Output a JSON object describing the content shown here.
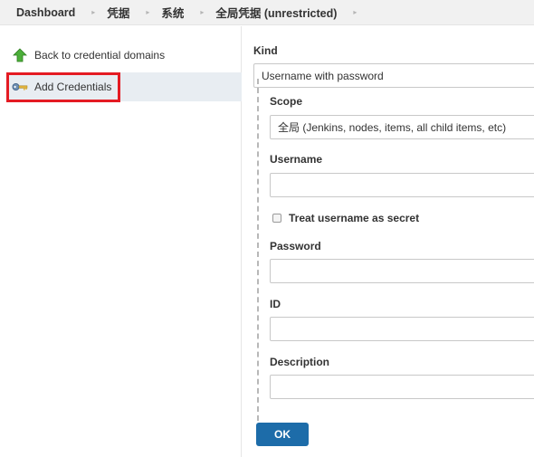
{
  "breadcrumb": {
    "items": [
      "Dashboard",
      "凭据",
      "系统",
      "全局凭据 (unrestricted)"
    ],
    "separator": "›"
  },
  "sidebar": {
    "back_label": "Back to credential domains",
    "add_label": "Add Credentials",
    "back_icon": "green-up-arrow-icon",
    "add_icon": "key-icon"
  },
  "form": {
    "kind_label": "Kind",
    "kind_value": "Username with password",
    "scope_label": "Scope",
    "scope_value": "全局 (Jenkins, nodes, items, all child items, etc)",
    "username_label": "Username",
    "username_value": "",
    "treat_secret_label": "Treat username as secret",
    "password_label": "Password",
    "password_value": "",
    "id_label": "ID",
    "id_value": "",
    "description_label": "Description",
    "description_value": "",
    "ok_label": "OK"
  },
  "colors": {
    "accent": "#1d6ca9",
    "highlight": "#e41b23",
    "selected_bg": "#e8edf2"
  }
}
